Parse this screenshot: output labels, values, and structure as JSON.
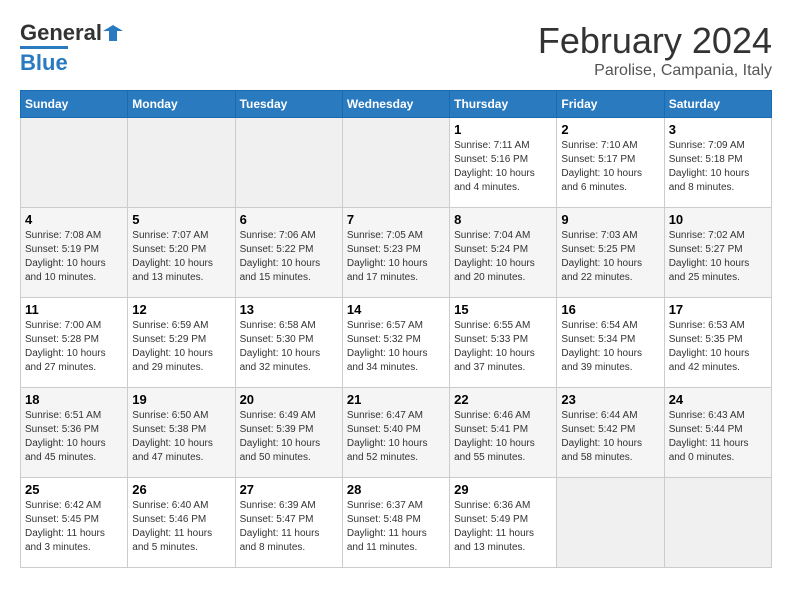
{
  "header": {
    "logo_general": "General",
    "logo_blue": "Blue",
    "month_title": "February 2024",
    "location": "Parolise, Campania, Italy"
  },
  "days_of_week": [
    "Sunday",
    "Monday",
    "Tuesday",
    "Wednesday",
    "Thursday",
    "Friday",
    "Saturday"
  ],
  "weeks": [
    [
      {
        "day": "",
        "empty": true
      },
      {
        "day": "",
        "empty": true
      },
      {
        "day": "",
        "empty": true
      },
      {
        "day": "",
        "empty": true
      },
      {
        "day": "1",
        "sunrise": "Sunrise: 7:11 AM",
        "sunset": "Sunset: 5:16 PM",
        "daylight": "Daylight: 10 hours and 4 minutes."
      },
      {
        "day": "2",
        "sunrise": "Sunrise: 7:10 AM",
        "sunset": "Sunset: 5:17 PM",
        "daylight": "Daylight: 10 hours and 6 minutes."
      },
      {
        "day": "3",
        "sunrise": "Sunrise: 7:09 AM",
        "sunset": "Sunset: 5:18 PM",
        "daylight": "Daylight: 10 hours and 8 minutes."
      }
    ],
    [
      {
        "day": "4",
        "sunrise": "Sunrise: 7:08 AM",
        "sunset": "Sunset: 5:19 PM",
        "daylight": "Daylight: 10 hours and 10 minutes."
      },
      {
        "day": "5",
        "sunrise": "Sunrise: 7:07 AM",
        "sunset": "Sunset: 5:20 PM",
        "daylight": "Daylight: 10 hours and 13 minutes."
      },
      {
        "day": "6",
        "sunrise": "Sunrise: 7:06 AM",
        "sunset": "Sunset: 5:22 PM",
        "daylight": "Daylight: 10 hours and 15 minutes."
      },
      {
        "day": "7",
        "sunrise": "Sunrise: 7:05 AM",
        "sunset": "Sunset: 5:23 PM",
        "daylight": "Daylight: 10 hours and 17 minutes."
      },
      {
        "day": "8",
        "sunrise": "Sunrise: 7:04 AM",
        "sunset": "Sunset: 5:24 PM",
        "daylight": "Daylight: 10 hours and 20 minutes."
      },
      {
        "day": "9",
        "sunrise": "Sunrise: 7:03 AM",
        "sunset": "Sunset: 5:25 PM",
        "daylight": "Daylight: 10 hours and 22 minutes."
      },
      {
        "day": "10",
        "sunrise": "Sunrise: 7:02 AM",
        "sunset": "Sunset: 5:27 PM",
        "daylight": "Daylight: 10 hours and 25 minutes."
      }
    ],
    [
      {
        "day": "11",
        "sunrise": "Sunrise: 7:00 AM",
        "sunset": "Sunset: 5:28 PM",
        "daylight": "Daylight: 10 hours and 27 minutes."
      },
      {
        "day": "12",
        "sunrise": "Sunrise: 6:59 AM",
        "sunset": "Sunset: 5:29 PM",
        "daylight": "Daylight: 10 hours and 29 minutes."
      },
      {
        "day": "13",
        "sunrise": "Sunrise: 6:58 AM",
        "sunset": "Sunset: 5:30 PM",
        "daylight": "Daylight: 10 hours and 32 minutes."
      },
      {
        "day": "14",
        "sunrise": "Sunrise: 6:57 AM",
        "sunset": "Sunset: 5:32 PM",
        "daylight": "Daylight: 10 hours and 34 minutes."
      },
      {
        "day": "15",
        "sunrise": "Sunrise: 6:55 AM",
        "sunset": "Sunset: 5:33 PM",
        "daylight": "Daylight: 10 hours and 37 minutes."
      },
      {
        "day": "16",
        "sunrise": "Sunrise: 6:54 AM",
        "sunset": "Sunset: 5:34 PM",
        "daylight": "Daylight: 10 hours and 39 minutes."
      },
      {
        "day": "17",
        "sunrise": "Sunrise: 6:53 AM",
        "sunset": "Sunset: 5:35 PM",
        "daylight": "Daylight: 10 hours and 42 minutes."
      }
    ],
    [
      {
        "day": "18",
        "sunrise": "Sunrise: 6:51 AM",
        "sunset": "Sunset: 5:36 PM",
        "daylight": "Daylight: 10 hours and 45 minutes."
      },
      {
        "day": "19",
        "sunrise": "Sunrise: 6:50 AM",
        "sunset": "Sunset: 5:38 PM",
        "daylight": "Daylight: 10 hours and 47 minutes."
      },
      {
        "day": "20",
        "sunrise": "Sunrise: 6:49 AM",
        "sunset": "Sunset: 5:39 PM",
        "daylight": "Daylight: 10 hours and 50 minutes."
      },
      {
        "day": "21",
        "sunrise": "Sunrise: 6:47 AM",
        "sunset": "Sunset: 5:40 PM",
        "daylight": "Daylight: 10 hours and 52 minutes."
      },
      {
        "day": "22",
        "sunrise": "Sunrise: 6:46 AM",
        "sunset": "Sunset: 5:41 PM",
        "daylight": "Daylight: 10 hours and 55 minutes."
      },
      {
        "day": "23",
        "sunrise": "Sunrise: 6:44 AM",
        "sunset": "Sunset: 5:42 PM",
        "daylight": "Daylight: 10 hours and 58 minutes."
      },
      {
        "day": "24",
        "sunrise": "Sunrise: 6:43 AM",
        "sunset": "Sunset: 5:44 PM",
        "daylight": "Daylight: 11 hours and 0 minutes."
      }
    ],
    [
      {
        "day": "25",
        "sunrise": "Sunrise: 6:42 AM",
        "sunset": "Sunset: 5:45 PM",
        "daylight": "Daylight: 11 hours and 3 minutes."
      },
      {
        "day": "26",
        "sunrise": "Sunrise: 6:40 AM",
        "sunset": "Sunset: 5:46 PM",
        "daylight": "Daylight: 11 hours and 5 minutes."
      },
      {
        "day": "27",
        "sunrise": "Sunrise: 6:39 AM",
        "sunset": "Sunset: 5:47 PM",
        "daylight": "Daylight: 11 hours and 8 minutes."
      },
      {
        "day": "28",
        "sunrise": "Sunrise: 6:37 AM",
        "sunset": "Sunset: 5:48 PM",
        "daylight": "Daylight: 11 hours and 11 minutes."
      },
      {
        "day": "29",
        "sunrise": "Sunrise: 6:36 AM",
        "sunset": "Sunset: 5:49 PM",
        "daylight": "Daylight: 11 hours and 13 minutes."
      },
      {
        "day": "",
        "empty": true
      },
      {
        "day": "",
        "empty": true
      }
    ]
  ]
}
